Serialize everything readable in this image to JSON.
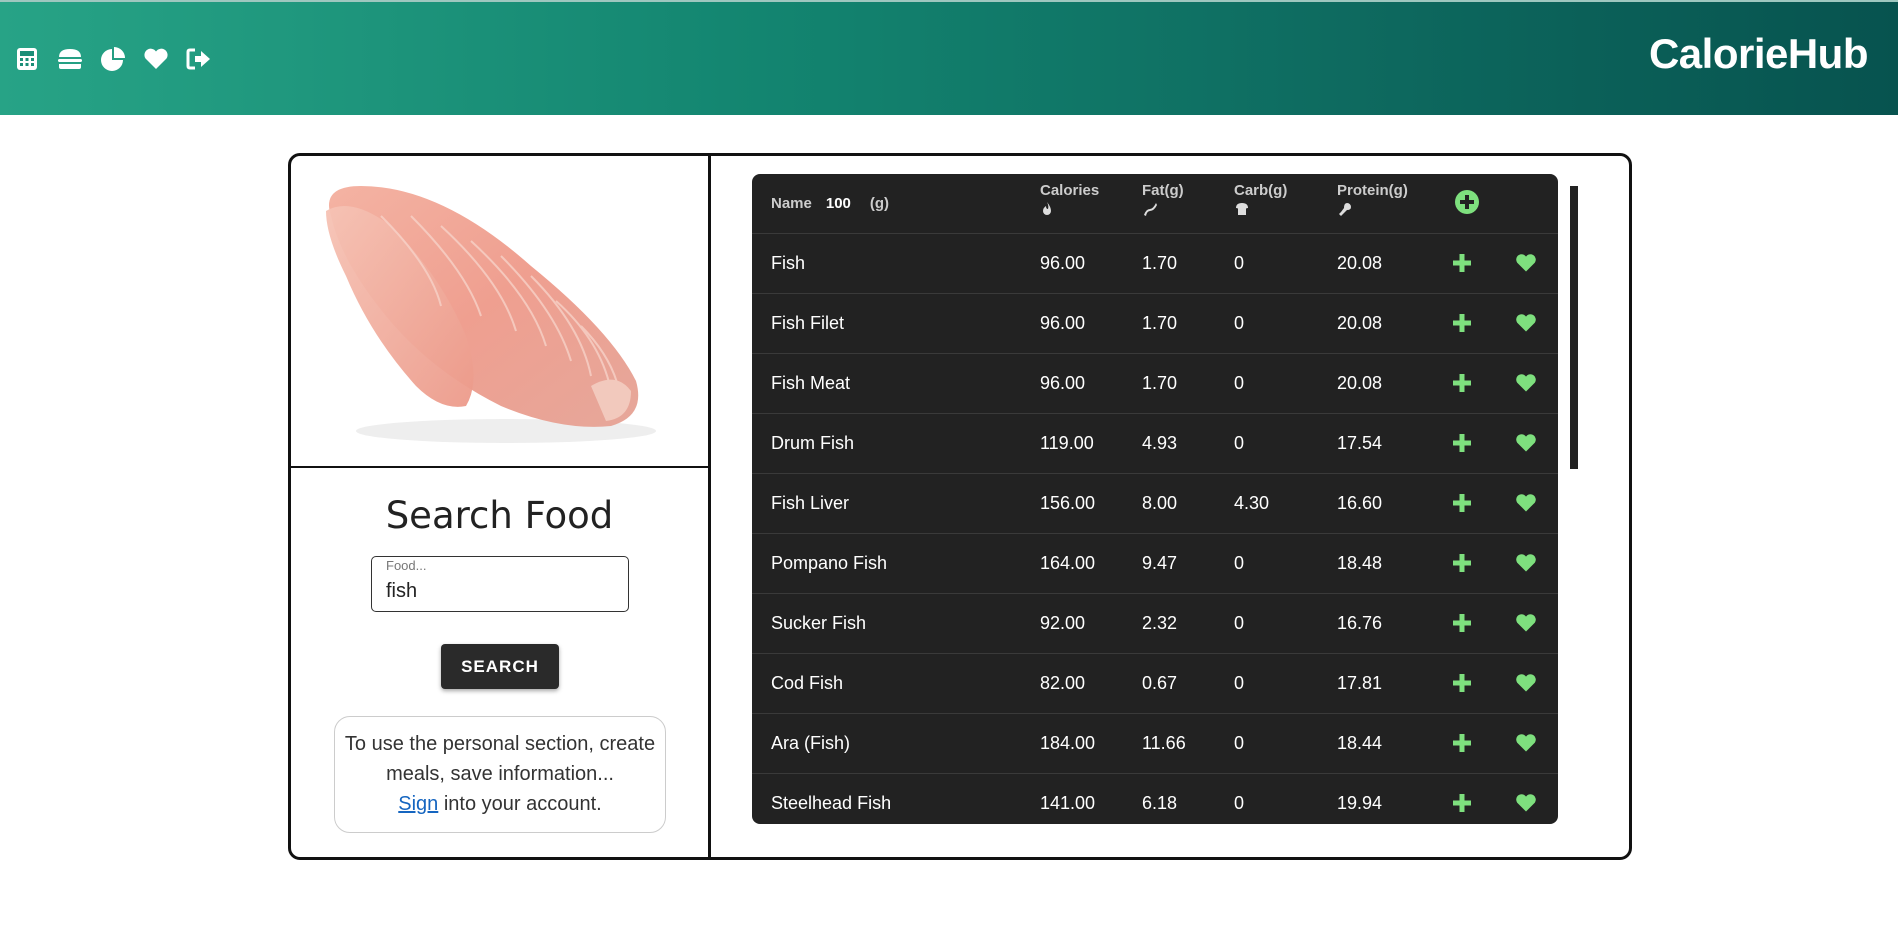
{
  "app": {
    "brand": "CalorieHub",
    "nav_icons": [
      "calculator-icon",
      "burger-icon",
      "pie-chart-icon",
      "heart-icon",
      "logout-icon"
    ]
  },
  "colors": {
    "header_gradient_start": "#27a386",
    "header_gradient_end": "#07534f",
    "table_bg": "#222222",
    "accent_green": "#7ee07e",
    "link_blue": "#1565c0"
  },
  "left_panel": {
    "image": "fish-fillet-image",
    "title": "Search Food",
    "search_label": "Food...",
    "search_value": "fish",
    "search_button": "SEARCH",
    "signin": {
      "text_before": "To use the personal section, create meals, save information...",
      "link": "Sign",
      "text_after": " into your account."
    }
  },
  "table": {
    "headers": {
      "name": "Name",
      "grams": "100",
      "grams_unit": "(g)",
      "calories": "Calories",
      "fat": "Fat(g)",
      "carb": "Carb(g)",
      "protein": "Protein(g)"
    },
    "rows": [
      {
        "name": "Fish",
        "calories": "96.00",
        "fat": "1.70",
        "carb": "0",
        "protein": "20.08"
      },
      {
        "name": "Fish Filet",
        "calories": "96.00",
        "fat": "1.70",
        "carb": "0",
        "protein": "20.08"
      },
      {
        "name": "Fish Meat",
        "calories": "96.00",
        "fat": "1.70",
        "carb": "0",
        "protein": "20.08"
      },
      {
        "name": "Drum Fish",
        "calories": "119.00",
        "fat": "4.93",
        "carb": "0",
        "protein": "17.54"
      },
      {
        "name": "Fish Liver",
        "calories": "156.00",
        "fat": "8.00",
        "carb": "4.30",
        "protein": "16.60"
      },
      {
        "name": "Pompano Fish",
        "calories": "164.00",
        "fat": "9.47",
        "carb": "0",
        "protein": "18.48"
      },
      {
        "name": "Sucker Fish",
        "calories": "92.00",
        "fat": "2.32",
        "carb": "0",
        "protein": "16.76"
      },
      {
        "name": "Cod Fish",
        "calories": "82.00",
        "fat": "0.67",
        "carb": "0",
        "protein": "17.81"
      },
      {
        "name": "Ara (Fish)",
        "calories": "184.00",
        "fat": "11.66",
        "carb": "0",
        "protein": "18.44"
      },
      {
        "name": "Steelhead Fish",
        "calories": "141.00",
        "fat": "6.18",
        "carb": "0",
        "protein": "19.94"
      }
    ]
  }
}
